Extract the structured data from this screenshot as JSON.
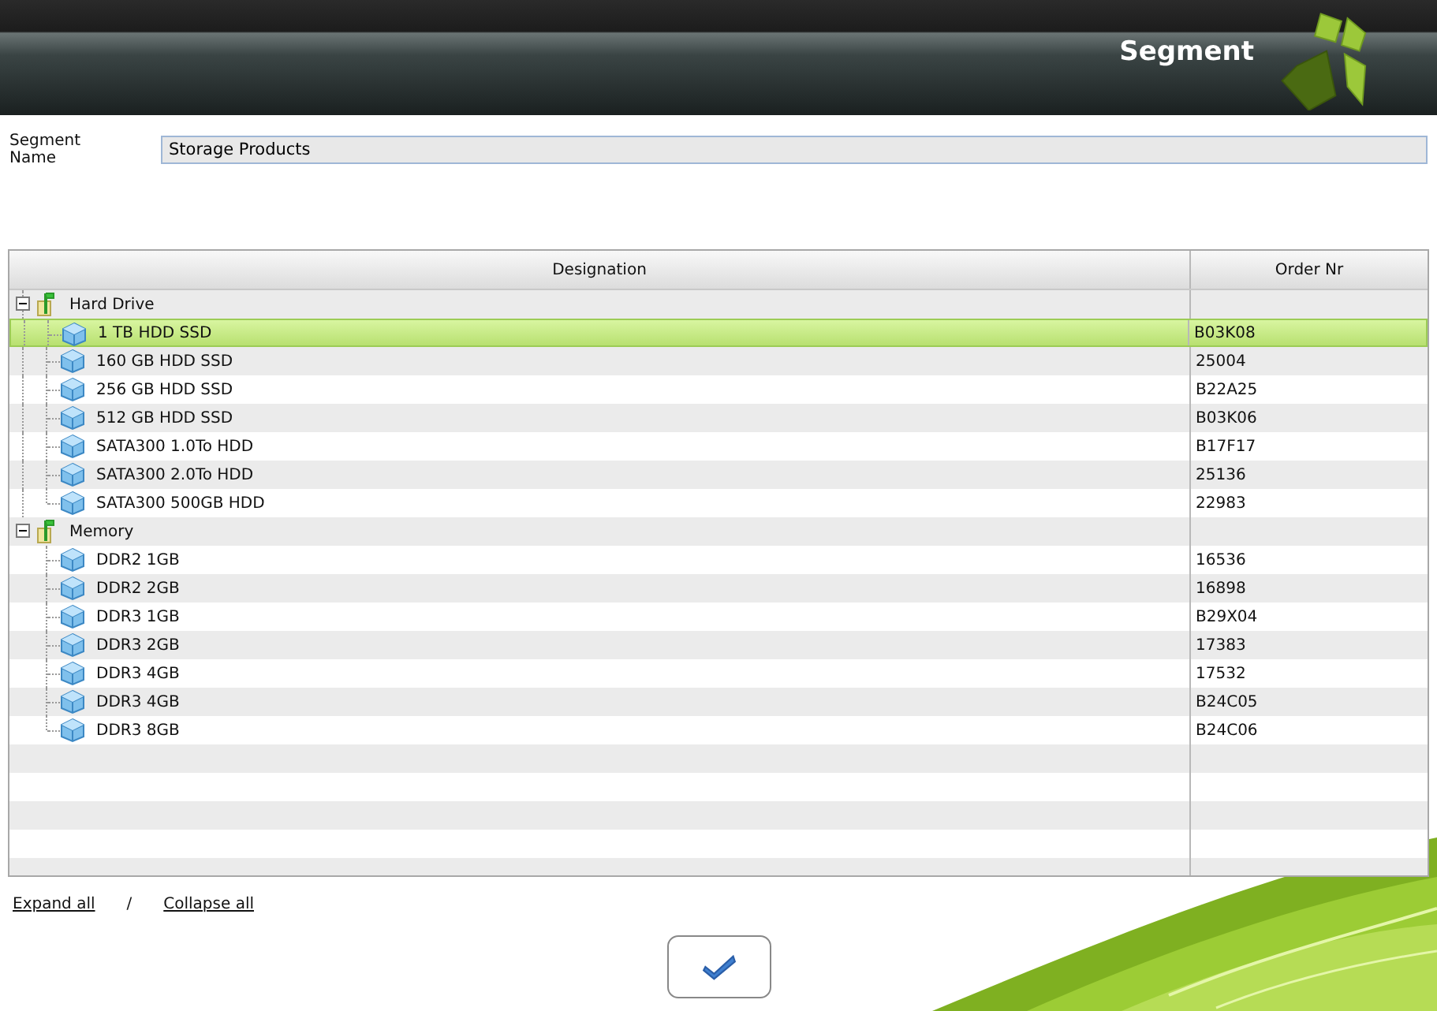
{
  "header": {
    "title": "Segment"
  },
  "segment_name": {
    "label": "Segment Name",
    "value": "Storage Products"
  },
  "table": {
    "columns": [
      "Designation",
      "Order Nr"
    ],
    "groups": [
      {
        "name": "Hard Drive",
        "expanded": true,
        "children": [
          {
            "name": "1 TB HDD SSD",
            "order_nr": "B03K08",
            "selected": true
          },
          {
            "name": "160 GB HDD SSD",
            "order_nr": "25004",
            "selected": false
          },
          {
            "name": "256 GB HDD SSD",
            "order_nr": "B22A25",
            "selected": false
          },
          {
            "name": "512 GB HDD SSD",
            "order_nr": "B03K06",
            "selected": false
          },
          {
            "name": "SATA300 1.0To HDD",
            "order_nr": "B17F17",
            "selected": false
          },
          {
            "name": "SATA300 2.0To HDD",
            "order_nr": "25136",
            "selected": false
          },
          {
            "name": "SATA300 500GB HDD",
            "order_nr": "22983",
            "selected": false
          }
        ]
      },
      {
        "name": "Memory",
        "expanded": true,
        "children": [
          {
            "name": "DDR2 1GB",
            "order_nr": "16536",
            "selected": false
          },
          {
            "name": "DDR2 2GB",
            "order_nr": "16898",
            "selected": false
          },
          {
            "name": "DDR3 1GB",
            "order_nr": "B29X04",
            "selected": false
          },
          {
            "name": "DDR3 2GB",
            "order_nr": "17383",
            "selected": false
          },
          {
            "name": "DDR3 4GB",
            "order_nr": "17532",
            "selected": false
          },
          {
            "name": "DDR3 4GB",
            "order_nr": "B24C05",
            "selected": false
          },
          {
            "name": "DDR3 8GB",
            "order_nr": "B24C06",
            "selected": false
          }
        ]
      }
    ]
  },
  "links": [
    {
      "label": "Expand all"
    },
    {
      "label": "Collapse all"
    }
  ],
  "separator": "/"
}
